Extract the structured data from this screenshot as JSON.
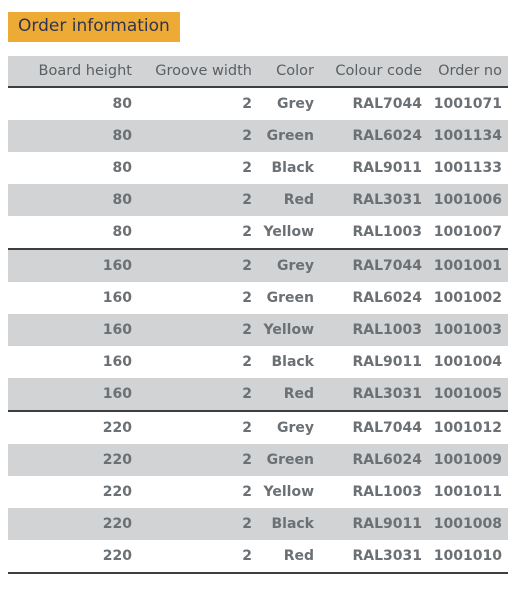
{
  "title": {
    "label": "Order information",
    "background_color": "#edaa35",
    "text_color": "#2f3450"
  },
  "table": {
    "header_background": "#d1d3d4",
    "stripe_color": "#d1d3d4",
    "rule_color": "#3c3f41",
    "columns": [
      "Board height",
      "Groove width",
      "Color",
      "Colour code",
      "Order no"
    ],
    "rows": [
      {
        "board_height": "80",
        "groove_width": "2",
        "color": "Grey",
        "colour_code": "RAL7044",
        "order_no": "1001071"
      },
      {
        "board_height": "80",
        "groove_width": "2",
        "color": "Green",
        "colour_code": "RAL6024",
        "order_no": "1001134"
      },
      {
        "board_height": "80",
        "groove_width": "2",
        "color": "Black",
        "colour_code": "RAL9011",
        "order_no": "1001133"
      },
      {
        "board_height": "80",
        "groove_width": "2",
        "color": "Red",
        "colour_code": "RAL3031",
        "order_no": "1001006"
      },
      {
        "board_height": "80",
        "groove_width": "2",
        "color": "Yellow",
        "colour_code": "RAL1003",
        "order_no": "1001007"
      },
      {
        "board_height": "160",
        "groove_width": "2",
        "color": "Grey",
        "colour_code": "RAL7044",
        "order_no": "1001001"
      },
      {
        "board_height": "160",
        "groove_width": "2",
        "color": "Green",
        "colour_code": "RAL6024",
        "order_no": "1001002"
      },
      {
        "board_height": "160",
        "groove_width": "2",
        "color": "Yellow",
        "colour_code": "RAL1003",
        "order_no": "1001003"
      },
      {
        "board_height": "160",
        "groove_width": "2",
        "color": "Black",
        "colour_code": "RAL9011",
        "order_no": "1001004"
      },
      {
        "board_height": "160",
        "groove_width": "2",
        "color": "Red",
        "colour_code": "RAL3031",
        "order_no": "1001005"
      },
      {
        "board_height": "220",
        "groove_width": "2",
        "color": "Grey",
        "colour_code": "RAL7044",
        "order_no": "1001012"
      },
      {
        "board_height": "220",
        "groove_width": "2",
        "color": "Green",
        "colour_code": "RAL6024",
        "order_no": "1001009"
      },
      {
        "board_height": "220",
        "groove_width": "2",
        "color": "Yellow",
        "colour_code": "RAL1003",
        "order_no": "1001011"
      },
      {
        "board_height": "220",
        "groove_width": "2",
        "color": "Black",
        "colour_code": "RAL9011",
        "order_no": "1001008"
      },
      {
        "board_height": "220",
        "groove_width": "2",
        "color": "Red",
        "colour_code": "RAL3031",
        "order_no": "1001010"
      }
    ],
    "group_start_indices": [
      0,
      5,
      10
    ],
    "striped_indices": [
      1,
      3,
      5,
      7,
      9,
      11,
      13
    ]
  }
}
